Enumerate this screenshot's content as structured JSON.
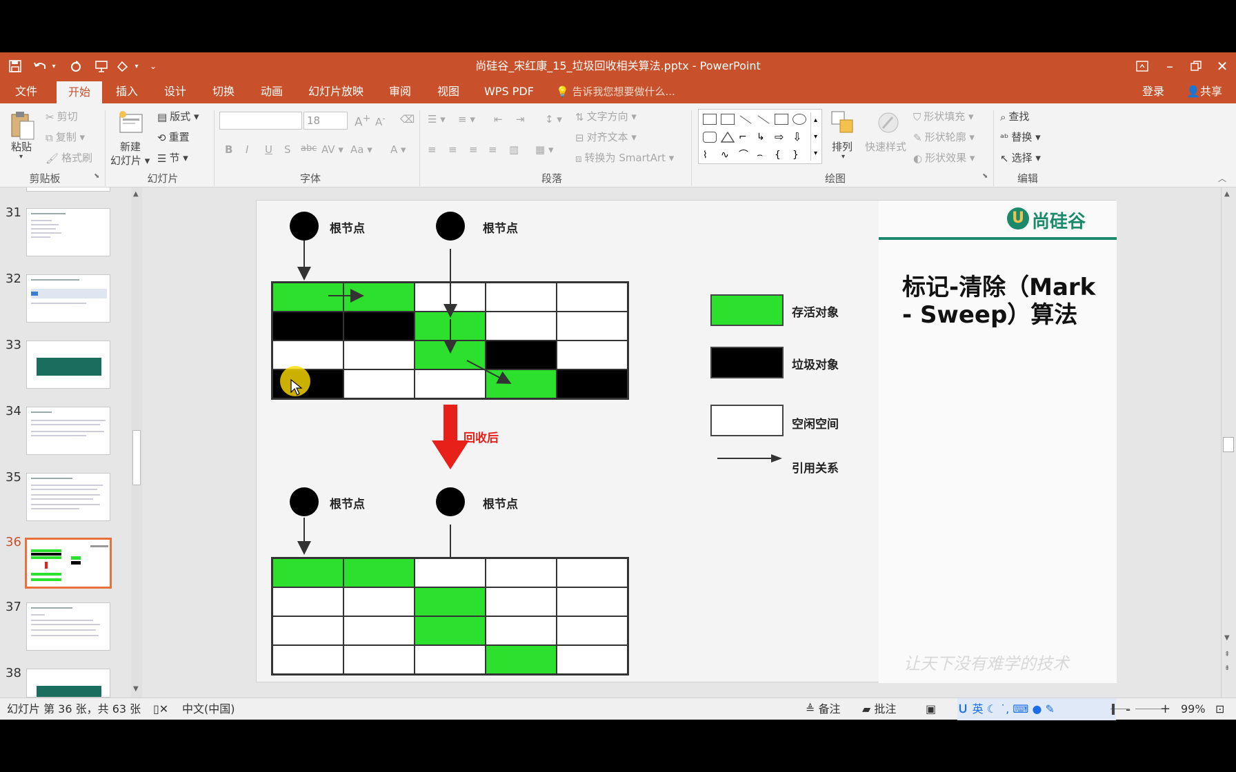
{
  "window": {
    "title": "尚硅谷_宋红康_15_垃圾回收相关算法.pptx - PowerPoint"
  },
  "tabs": [
    {
      "label": "文件"
    },
    {
      "label": "开始"
    },
    {
      "label": "插入"
    },
    {
      "label": "设计"
    },
    {
      "label": "切换"
    },
    {
      "label": "动画"
    },
    {
      "label": "幻灯片放映"
    },
    {
      "label": "审阅"
    },
    {
      "label": "视图"
    },
    {
      "label": "WPS PDF"
    }
  ],
  "tellme": "告诉我您想要做什么...",
  "login": "登录",
  "share": "共享",
  "ribbon": {
    "clipboard": {
      "paste": "粘贴",
      "cut": "剪切",
      "copy": "复制",
      "format_painter": "格式刷",
      "group": "剪贴板"
    },
    "slides": {
      "new": "新建",
      "new2": "幻灯片",
      "layout": "版式",
      "reset": "重置",
      "section": "节",
      "group": "幻灯片"
    },
    "font": {
      "size": "18",
      "group": "字体"
    },
    "paragraph": {
      "text_dir": "文字方向",
      "align_text": "对齐文本",
      "smartart": "转换为 SmartArt",
      "group": "段落"
    },
    "drawing": {
      "arrange": "排列",
      "quick_styles": "快速样式",
      "fill": "形状填充",
      "outline": "形状轮廓",
      "effects": "形状效果",
      "group": "绘图"
    },
    "editing": {
      "find": "查找",
      "replace": "替换",
      "select": "选择",
      "group": "编辑"
    }
  },
  "thumbnails": [
    {
      "num": "31",
      "selected": false
    },
    {
      "num": "32",
      "selected": false
    },
    {
      "num": "33",
      "selected": false
    },
    {
      "num": "34",
      "selected": false
    },
    {
      "num": "35",
      "selected": false
    },
    {
      "num": "36",
      "selected": true
    },
    {
      "num": "37",
      "selected": false
    },
    {
      "num": "38",
      "selected": false
    }
  ],
  "slide": {
    "root_label": "根节点",
    "after_label": "回收后",
    "brand": "尚硅谷",
    "heading_line1": "标记-清除（Mark",
    "heading_line2": "- Sweep）算法",
    "legend": {
      "alive": "存活对象",
      "garbage": "垃圾对象",
      "free": "空闲空间",
      "ref": "引用关系"
    },
    "slogan": "让天下没有难学的技术",
    "grid_before": [
      [
        "g",
        "g",
        "w",
        "w",
        "w"
      ],
      [
        "b",
        "b",
        "g",
        "w",
        "w"
      ],
      [
        "w",
        "w",
        "g",
        "b",
        "w"
      ],
      [
        "b",
        "w",
        "w",
        "g",
        "b"
      ]
    ],
    "grid_after": [
      [
        "g",
        "g",
        "w",
        "w",
        "w"
      ],
      [
        "w",
        "w",
        "g",
        "w",
        "w"
      ],
      [
        "w",
        "w",
        "g",
        "w",
        "w"
      ],
      [
        "w",
        "w",
        "w",
        "g",
        "w"
      ]
    ]
  },
  "status": {
    "slide_info": "幻灯片 第 36 张，共 63 张",
    "language": "中文(中国)",
    "notes": "备注",
    "comments": "批注",
    "ime": "英",
    "zoom": "99%"
  },
  "colors": {
    "accent": "#c8512b",
    "alive": "#2ee02e",
    "brand": "#1b8a6b",
    "arrow": "#e8201a"
  }
}
